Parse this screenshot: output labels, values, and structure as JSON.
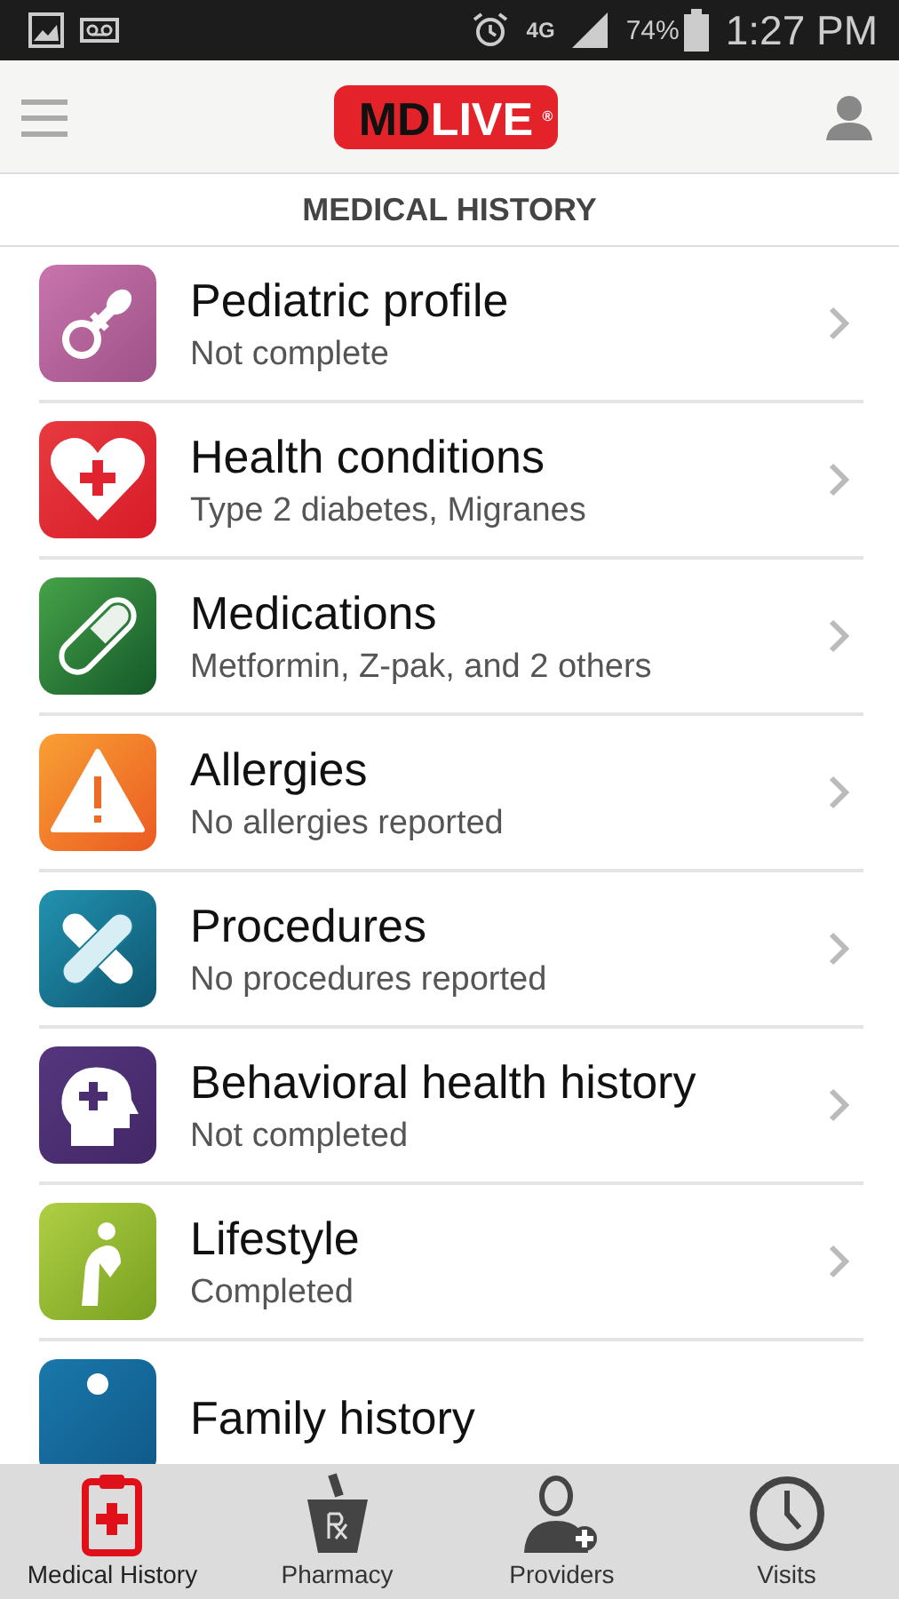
{
  "status_bar": {
    "network": "4G",
    "battery": "74%",
    "time": "1:27 PM"
  },
  "header": {
    "logo_dark": "MD",
    "logo_light": "LIVE",
    "logo_mark": "®"
  },
  "page_title": "MEDICAL HISTORY",
  "items": [
    {
      "kind": "pediatric",
      "title": "Pediatric profile",
      "subtitle": "Not complete"
    },
    {
      "kind": "health",
      "title": "Health conditions",
      "subtitle": "Type 2 diabetes, Migranes"
    },
    {
      "kind": "medications",
      "title": "Medications",
      "subtitle": "Metformin, Z-pak, and 2 others"
    },
    {
      "kind": "allergies",
      "title": "Allergies",
      "subtitle": "No allergies reported"
    },
    {
      "kind": "procedures",
      "title": "Procedures",
      "subtitle": "No procedures reported"
    },
    {
      "kind": "behavioral",
      "title": "Behavioral health history",
      "subtitle": "Not completed"
    },
    {
      "kind": "lifestyle",
      "title": "Lifestyle",
      "subtitle": "Completed"
    },
    {
      "kind": "family",
      "title": "Family history"
    }
  ],
  "tabs": [
    {
      "kind": "clipboard",
      "label": "Medical History",
      "selected": true
    },
    {
      "kind": "pharmacy",
      "label": "Pharmacy",
      "selected": false
    },
    {
      "kind": "providers",
      "label": "Providers",
      "selected": false
    },
    {
      "kind": "visits",
      "label": "Visits",
      "selected": false
    }
  ]
}
